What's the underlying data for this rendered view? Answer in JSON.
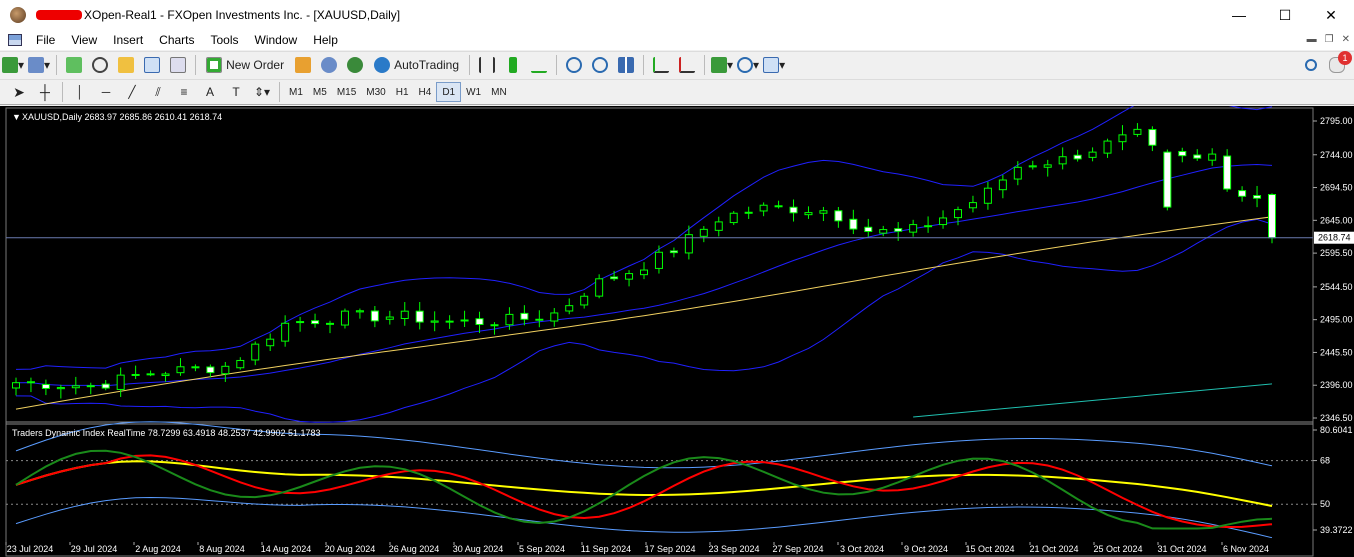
{
  "window": {
    "title": "XOpen-Real1 - FXOpen Investments Inc. - [XAUUSD,Daily]",
    "minimize": "—",
    "maximize": "☐",
    "close": "✕"
  },
  "menu": [
    "File",
    "View",
    "Insert",
    "Charts",
    "Tools",
    "Window",
    "Help"
  ],
  "toolbar": {
    "new_order": "New Order",
    "auto_trading": "AutoTrading",
    "alert_count": "1"
  },
  "timeframes": [
    "M1",
    "M5",
    "M15",
    "M30",
    "H1",
    "H4",
    "D1",
    "W1",
    "MN"
  ],
  "active_timeframe": "D1",
  "chart": {
    "header": "XAUUSD,Daily  2683.97 2685.86 2610.41 2618.74",
    "current_price": "2618.74",
    "price_ticks": [
      "2795.00",
      "2744.00",
      "2694.50",
      "2645.00",
      "2595.50",
      "2544.50",
      "2495.00",
      "2445.50",
      "2396.00",
      "2346.50"
    ],
    "indicator_header": "Traders Dynamic Index RealTime 78.7299 63.4918 48.2537 42.9902 51.1783",
    "indicator_ticks": [
      "80.6041",
      "68",
      "50",
      "39.3722"
    ],
    "date_ticks": [
      "23 Jul 2024",
      "29 Jul 2024",
      "2 Aug 2024",
      "8 Aug 2024",
      "14 Aug 2024",
      "20 Aug 2024",
      "26 Aug 2024",
      "30 Aug 2024",
      "5 Sep 2024",
      "11 Sep 2024",
      "17 Sep 2024",
      "23 Sep 2024",
      "27 Sep 2024",
      "3 Oct 2024",
      "9 Oct 2024",
      "15 Oct 2024",
      "21 Oct 2024",
      "25 Oct 2024",
      "31 Oct 2024",
      "6 Nov 2024"
    ],
    "colors": {
      "bull_outline": "#00ff00",
      "bear_fill": "#ffffff",
      "bollinger": "#2020ff",
      "ma_slow": "#f0d060",
      "ma_teal": "#20c0b0",
      "tdi_green": "#1a8a1a",
      "tdi_red": "#ff0000",
      "tdi_yellow": "#ffff00",
      "tdi_band": "#5a9cff"
    }
  }
}
